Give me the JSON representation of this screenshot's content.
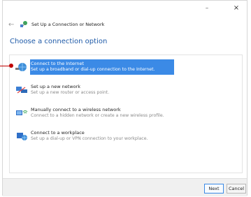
{
  "window": {
    "title_bar": {
      "minimize_glyph": "–",
      "close_glyph": "×"
    }
  },
  "nav": {
    "back_glyph": "←",
    "title": "Set Up a Connection or Network"
  },
  "heading": "Choose a connection option",
  "options": [
    {
      "title": "Connect to the Internet",
      "desc": "Set up a broadband or dial-up connection to the Internet.",
      "icon": "globe-network-icon",
      "selected": true
    },
    {
      "title": "Set up a new network",
      "desc": "Set up a new router or access point.",
      "icon": "router-network-icon",
      "selected": false
    },
    {
      "title": "Manually connect to a wireless network",
      "desc": "Connect to a hidden network or create a new wireless profile.",
      "icon": "wireless-network-icon",
      "selected": false
    },
    {
      "title": "Connect to a workplace",
      "desc": "Set up a dial-up or VPN connection to your workplace.",
      "icon": "workplace-network-icon",
      "selected": false
    }
  ],
  "footer": {
    "next_label": "Next",
    "cancel_label": "Cancel"
  },
  "colors": {
    "accent": "#3b8ae6",
    "heading": "#1e5aa8",
    "annotation": "#c00000"
  }
}
